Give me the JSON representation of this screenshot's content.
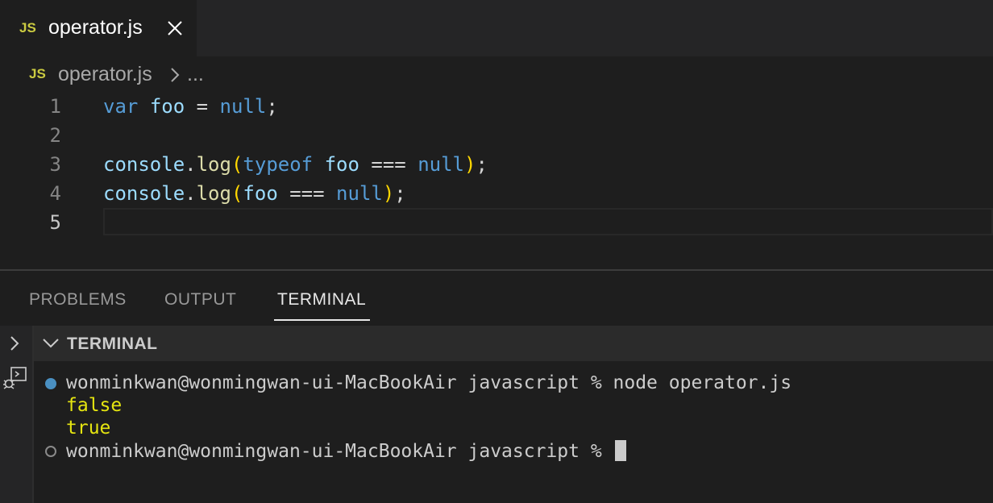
{
  "editor_tab": {
    "badge": "JS",
    "label": "operator.js"
  },
  "breadcrumb": {
    "badge": "JS",
    "file": "operator.js",
    "more": "..."
  },
  "code_lines": [
    {
      "number": "1"
    },
    {
      "number": "2"
    },
    {
      "number": "3"
    },
    {
      "number": "4"
    },
    {
      "number": "5"
    }
  ],
  "panel": {
    "tabs": [
      "PROBLEMS",
      "OUTPUT",
      "TERMINAL"
    ],
    "active_tab": "TERMINAL",
    "terminal_title": "TERMINAL"
  },
  "terminal": {
    "command_line": "wonminkwan@wonmingwan-ui-MacBookAir javascript % node operator.js",
    "output": [
      "false",
      "true"
    ],
    "prompt": "wonminkwan@wonmingwan-ui-MacBookAir javascript % "
  },
  "colors": {
    "keyword": "#569cd6",
    "variable": "#9cdcfe",
    "function": "#dcdcaa",
    "bracket": "#ffd700",
    "output": "#e5e510",
    "js_badge": "#cbcb41"
  }
}
